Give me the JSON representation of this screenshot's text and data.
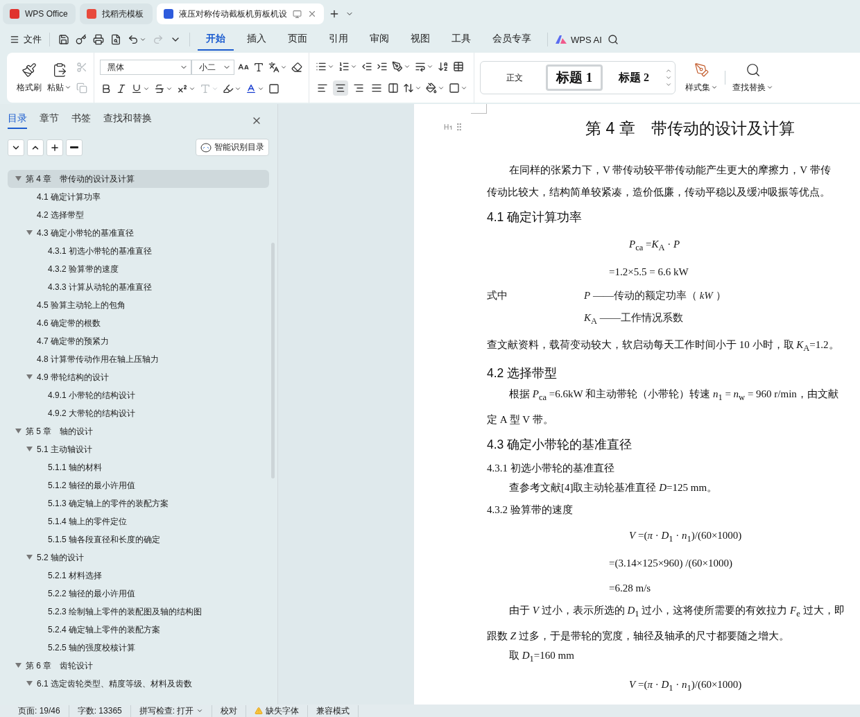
{
  "tabs": [
    {
      "kind": "wps",
      "label": "WPS Office",
      "selected": false
    },
    {
      "kind": "docer",
      "label": "找稻壳模板",
      "selected": false
    },
    {
      "kind": "writer",
      "label": "液压对称传动截板机剪板机设",
      "selected": true
    }
  ],
  "menu": {
    "file": "文件",
    "tabs": [
      {
        "label": "开始",
        "selected": true
      },
      {
        "label": "插入",
        "selected": false
      },
      {
        "label": "页面",
        "selected": false
      },
      {
        "label": "引用",
        "selected": false
      },
      {
        "label": "审阅",
        "selected": false
      },
      {
        "label": "视图",
        "selected": false
      },
      {
        "label": "工具",
        "selected": false
      },
      {
        "label": "会员专享",
        "selected": false
      }
    ],
    "ai": "WPS AI"
  },
  "ribbon": {
    "format_painter": "格式刷",
    "paste": "粘贴",
    "font": "黑体",
    "size": "小二",
    "align_buttons": [
      {
        "kind": "left",
        "selected": false
      },
      {
        "kind": "center",
        "selected": true
      },
      {
        "kind": "right",
        "selected": false
      },
      {
        "kind": "justify",
        "selected": false
      }
    ],
    "styles": [
      {
        "label": "正文",
        "kind": "body",
        "selected": false
      },
      {
        "label": "标题 1",
        "kind": "h1",
        "selected": true
      },
      {
        "label": "标题 2",
        "kind": "h2",
        "selected": false
      }
    ],
    "style_set": "样式集",
    "find_replace": "查找替换"
  },
  "panel": {
    "tabs": [
      {
        "label": "目录",
        "selected": true
      },
      {
        "label": "章节",
        "selected": false
      },
      {
        "label": "书签",
        "selected": false
      },
      {
        "label": "查找和替换",
        "selected": false
      }
    ],
    "smart_button": "智能识别目录",
    "outline": [
      {
        "label": "第 4 章　带传动的设计及计算",
        "expanded": true,
        "selected": true,
        "children": [
          {
            "label": "4.1  确定计算功率",
            "selected": false
          },
          {
            "label": "4.2  选择带型",
            "selected": false
          },
          {
            "label": "4.3  确定小带轮的基准直径",
            "expanded": true,
            "selected": false,
            "children": [
              {
                "label": "4.3.1 初选小带轮的基准直径",
                "selected": false
              },
              {
                "label": "4.3.2 验算带的速度",
                "selected": false
              },
              {
                "label": "4.3.3 计算从动轮的基准直径",
                "selected": false
              }
            ]
          },
          {
            "label": "4.5 验算主动轮上的包角",
            "selected": false
          },
          {
            "label": "4.6 确定带的根数",
            "selected": false
          },
          {
            "label": "4.7  确定带的预紧力",
            "selected": false
          },
          {
            "label": "4.8 计算带传动作用在轴上压轴力",
            "selected": false
          },
          {
            "label": "4.9  带轮结构的设计",
            "expanded": true,
            "selected": false,
            "children": [
              {
                "label": "4.9.1 小带轮的结构设计",
                "selected": false
              },
              {
                "label": "4.9.2 大带轮的结构设计",
                "selected": false
              }
            ]
          }
        ]
      },
      {
        "label": "第 5 章　轴的设计",
        "expanded": true,
        "selected": false,
        "children": [
          {
            "label": "5.1 主动轴设计",
            "expanded": true,
            "selected": false,
            "children": [
              {
                "label": "5.1.1 轴的材料",
                "selected": false
              },
              {
                "label": "5.1.2  轴径的最小许用值",
                "selected": false
              },
              {
                "label": "5.1.3 确定轴上的零件的装配方案",
                "selected": false
              },
              {
                "label": "5.1.4  轴上的零件定位",
                "selected": false
              },
              {
                "label": "5.1.5 轴各段直径和长度的确定",
                "selected": false
              }
            ]
          },
          {
            "label": "5.2 轴的设计",
            "expanded": true,
            "selected": false,
            "children": [
              {
                "label": "5.2.1 材料选择",
                "selected": false
              },
              {
                "label": "5.2.2 轴径的最小许用值",
                "selected": false
              },
              {
                "label": "5.2.3 绘制轴上零件的装配图及轴的结构图",
                "selected": false
              },
              {
                "label": "5.2.4 确定轴上零件的装配方案",
                "selected": false
              },
              {
                "label": "5.2.5 轴的强度校核计算",
                "selected": false
              }
            ]
          }
        ]
      },
      {
        "label": "第 6 章　齿轮设计",
        "expanded": true,
        "selected": false,
        "children": [
          {
            "label": "6.1 选定齿轮类型、精度等级、材料及齿数",
            "expanded": true,
            "selected": false
          }
        ]
      }
    ]
  },
  "document": [
    {
      "kind": "title",
      "text": "第 4 章　带传动的设计及计算"
    },
    {
      "kind": "indented",
      "text": "在同样的张紧力下，V 带传动较平带传动能产生更大的摩擦力，V 带传"
    },
    {
      "kind": "para",
      "text": "传动比较大，结构简单较紧凑，造价低廉，传动平稳以及缓冲吸振等优点。"
    },
    {
      "kind": "h2",
      "text": "4.1  确定计算功率"
    },
    {
      "kind": "formula",
      "text": "*P*$_{ca}$ =*K*$_{A}$ · *P*"
    },
    {
      "kind": "step",
      "text": "=1.2×5.5 = 6.6 kW"
    },
    {
      "kind": "where",
      "label": "式中",
      "text": "*P* ——传动的额定功率（ *kW* ）"
    },
    {
      "kind": "where",
      "text": "*K*$_{A}$ ——工作情况系数"
    },
    {
      "kind": "para",
      "text": "查文献资料，载荷变动较大，软启动每天工作时间小于 10 小时，取 *K*$_{A}$=1.2。"
    },
    {
      "kind": "h2",
      "text": "4.2  选择带型"
    },
    {
      "kind": "indented",
      "text": "根据 *P*$_{ca}$ =6.6kW 和主动带轮（小带轮）转速 *n*$_{1}$ = *n*$_{w}$ =  960 r/min，由文献"
    },
    {
      "kind": "para",
      "text": "定 A 型 V 带。"
    },
    {
      "kind": "h2",
      "text": "4.3  确定小带轮的基准直径"
    },
    {
      "kind": "h3",
      "text": "4.3.1 初选小带轮的基准直径"
    },
    {
      "kind": "indented",
      "text": "查参考文献[4]取主动轮基准直径 *D*=125 mm。"
    },
    {
      "kind": "h3",
      "text": "4.3.2 验算带的速度"
    },
    {
      "kind": "formula",
      "text": "*V* =(*π* · *D*$_{1}$ · *n*$_{1}$)/(60×1000)"
    },
    {
      "kind": "step",
      "text": "=(3.14×125×960) /(60×1000)"
    },
    {
      "kind": "step",
      "text": "=6.28 m/s"
    },
    {
      "kind": "indented",
      "text": "由于 *V* 过小，表示所选的 *D*$_{1}$ 过小，这将使所需要的有效拉力 *F*$_{e}$ 过大，即"
    },
    {
      "kind": "para",
      "text": "跟数 *Z* 过多，于是带轮的宽度，轴径及轴承的尺寸都要随之增大。"
    },
    {
      "kind": "indented",
      "text": "取 *D*$_{1}$=160 mm"
    },
    {
      "kind": "formula",
      "text": "*V* =(*π* · *D*$_{1}$ · *n*$_{1}$)/(60×1000)"
    }
  ],
  "status": [
    {
      "kind": "text",
      "text": "页面: 19/46"
    },
    {
      "kind": "text",
      "text": "字数: 13365"
    },
    {
      "kind": "menu",
      "text": "拼写检查: 打开"
    },
    {
      "kind": "text",
      "text": "校对"
    },
    {
      "kind": "warning",
      "text": "缺失字体"
    },
    {
      "kind": "text",
      "text": "兼容模式"
    }
  ]
}
